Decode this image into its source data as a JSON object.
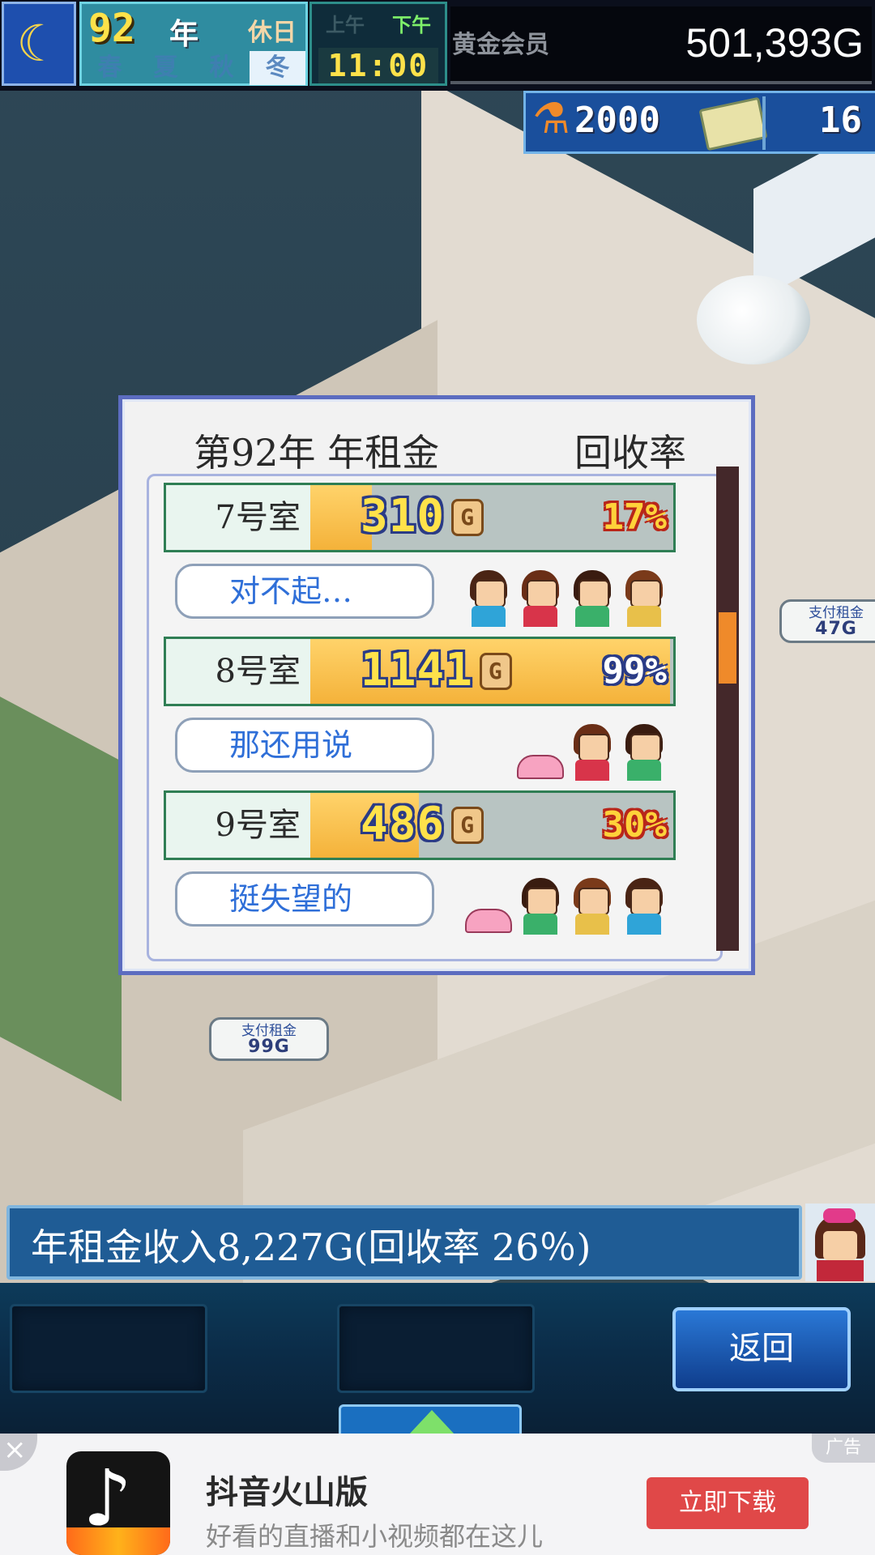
{
  "hud": {
    "year_number": "92",
    "year_word": "年",
    "holiday": "休日",
    "seasons": [
      "春",
      "夏",
      "秋",
      "冬"
    ],
    "active_season": "冬",
    "am": "上午",
    "pm": "下午",
    "time": "11:00",
    "membership": "黄金会员",
    "money": "501,393G",
    "research_points": "2000",
    "tickets": "16"
  },
  "dialog": {
    "title": "第92年 年租金",
    "rate_header": "回收率",
    "rooms": [
      {
        "label": "7号室",
        "rent": "310",
        "rate": "17%",
        "rate_value": 17,
        "comment": "对不起…",
        "tenant_count": 4
      },
      {
        "label": "8号室",
        "rent": "1141",
        "rate": "99%",
        "rate_value": 99,
        "comment": "那还用说",
        "tenant_count": 2
      },
      {
        "label": "9号室",
        "rent": "486",
        "rate": "30%",
        "rate_value": 30,
        "comment": "挺失望的",
        "tenant_count": 3
      }
    ],
    "currency_badge": "G"
  },
  "scene": {
    "rent_bubble_1_label": "支付租金",
    "rent_bubble_1_amount": "99G",
    "rent_bubble_2_label": "支付租金",
    "rent_bubble_2_amount": "47G"
  },
  "summary": {
    "text": "年租金收入8,227G(回收率 26％)"
  },
  "command_bar": {
    "back_label": "返回"
  },
  "ad": {
    "tag": "广告",
    "close": "×",
    "title": "抖音火山版",
    "subtitle": "好看的直播和小视频都在这儿",
    "button": "立即下载"
  },
  "colors": {
    "accent_blue": "#5c6cc0",
    "bar_fill": "#f4b23a",
    "rate_good": "#ffffff",
    "rate_bad": "#ffd23a",
    "ad_button": "#e04848"
  }
}
